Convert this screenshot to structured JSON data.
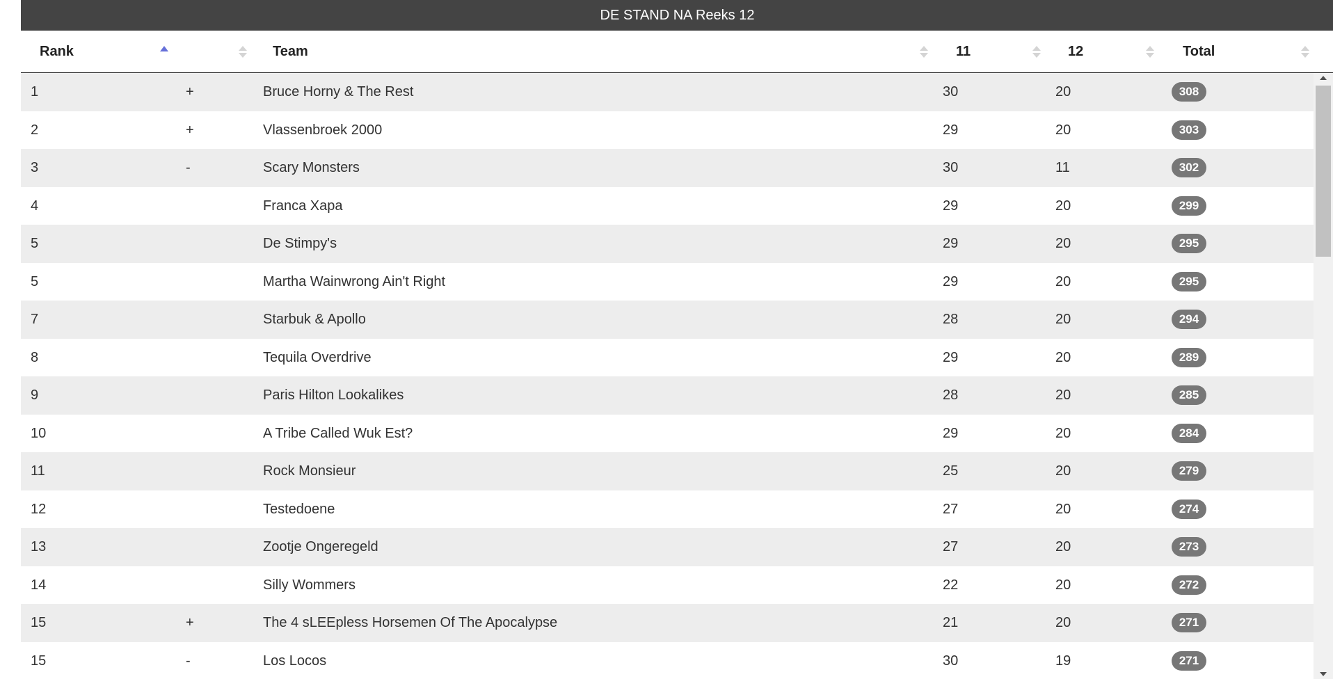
{
  "caption": "DE STAND NA Reeks 12",
  "columns": {
    "rank": "Rank",
    "move": "",
    "team": "Team",
    "r11": "11",
    "r12": "12",
    "total": "Total"
  },
  "rows": [
    {
      "rank": "1",
      "move": "+",
      "team": "Bruce Horny & The Rest",
      "r11": "30",
      "r12": "20",
      "total": "308"
    },
    {
      "rank": "2",
      "move": "+",
      "team": "Vlassenbroek 2000",
      "r11": "29",
      "r12": "20",
      "total": "303"
    },
    {
      "rank": "3",
      "move": "-",
      "team": "Scary Monsters",
      "r11": "30",
      "r12": "11",
      "total": "302"
    },
    {
      "rank": "4",
      "move": "",
      "team": "Franca Xapa",
      "r11": "29",
      "r12": "20",
      "total": "299"
    },
    {
      "rank": "5",
      "move": "",
      "team": "De Stimpy's",
      "r11": "29",
      "r12": "20",
      "total": "295"
    },
    {
      "rank": "5",
      "move": "",
      "team": "Martha Wainwrong Ain't Right",
      "r11": "29",
      "r12": "20",
      "total": "295"
    },
    {
      "rank": "7",
      "move": "",
      "team": "Starbuk & Apollo",
      "r11": "28",
      "r12": "20",
      "total": "294"
    },
    {
      "rank": "8",
      "move": "",
      "team": "Tequila Overdrive",
      "r11": "29",
      "r12": "20",
      "total": "289"
    },
    {
      "rank": "9",
      "move": "",
      "team": "Paris Hilton Lookalikes",
      "r11": "28",
      "r12": "20",
      "total": "285"
    },
    {
      "rank": "10",
      "move": "",
      "team": "A Tribe Called Wuk Est?",
      "r11": "29",
      "r12": "20",
      "total": "284"
    },
    {
      "rank": "11",
      "move": "",
      "team": "Rock Monsieur",
      "r11": "25",
      "r12": "20",
      "total": "279"
    },
    {
      "rank": "12",
      "move": "",
      "team": "Testedoene",
      "r11": "27",
      "r12": "20",
      "total": "274"
    },
    {
      "rank": "13",
      "move": "",
      "team": "Zootje Ongeregeld",
      "r11": "27",
      "r12": "20",
      "total": "273"
    },
    {
      "rank": "14",
      "move": "",
      "team": "Silly Wommers",
      "r11": "22",
      "r12": "20",
      "total": "272"
    },
    {
      "rank": "15",
      "move": "+",
      "team": "The 4 sLEEpless Horsemen Of The Apocalypse",
      "r11": "21",
      "r12": "20",
      "total": "271"
    },
    {
      "rank": "15",
      "move": "-",
      "team": "Los Locos",
      "r11": "30",
      "r12": "19",
      "total": "271"
    }
  ],
  "colors": {
    "caption_bg": "#444444",
    "row_stripe": "#ededed",
    "badge_bg": "#777777",
    "sort_active": "#6670d9"
  },
  "sort": {
    "column": "Rank",
    "direction": "ascending"
  }
}
